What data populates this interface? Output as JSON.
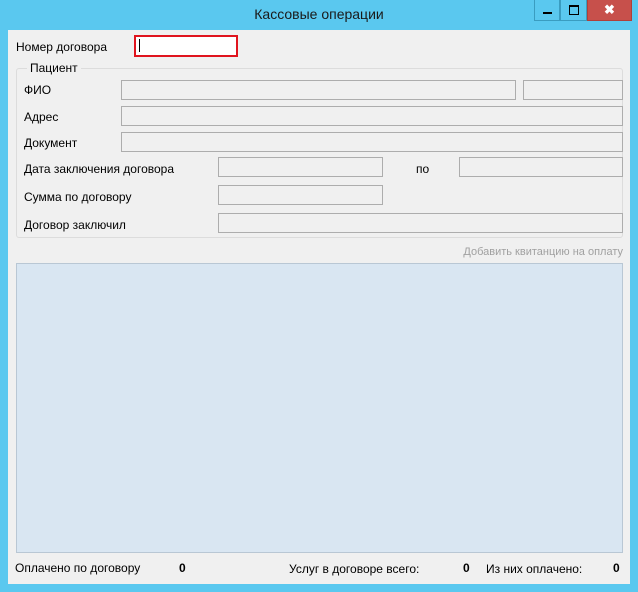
{
  "window": {
    "title": "Кассовые операции",
    "minimize_icon": "minimize-icon",
    "maximize_icon": "maximize-icon",
    "close_glyph": "✖",
    "accent": "#5ac8ef",
    "close_color": "#c7504b"
  },
  "contract_number": {
    "label": "Номер договора",
    "value": ""
  },
  "patient": {
    "group_title": "Пациент",
    "fio_label": "ФИО",
    "address_label": "Адрес",
    "document_label": "Документ",
    "contract_date_label": "Дата заключения договора",
    "to_label": "по",
    "contract_sum_label": "Сумма по договору",
    "contract_by_label": "Договор заключил"
  },
  "add_receipt_link": "Добавить квитанцию на оплату",
  "footer": {
    "paid_label": "Оплачено по договору",
    "paid_value": "0",
    "services_label": "Услуг в договоре всего:",
    "services_value": "0",
    "paid_count_label": "Из них оплачено:",
    "paid_count_value": "0"
  }
}
